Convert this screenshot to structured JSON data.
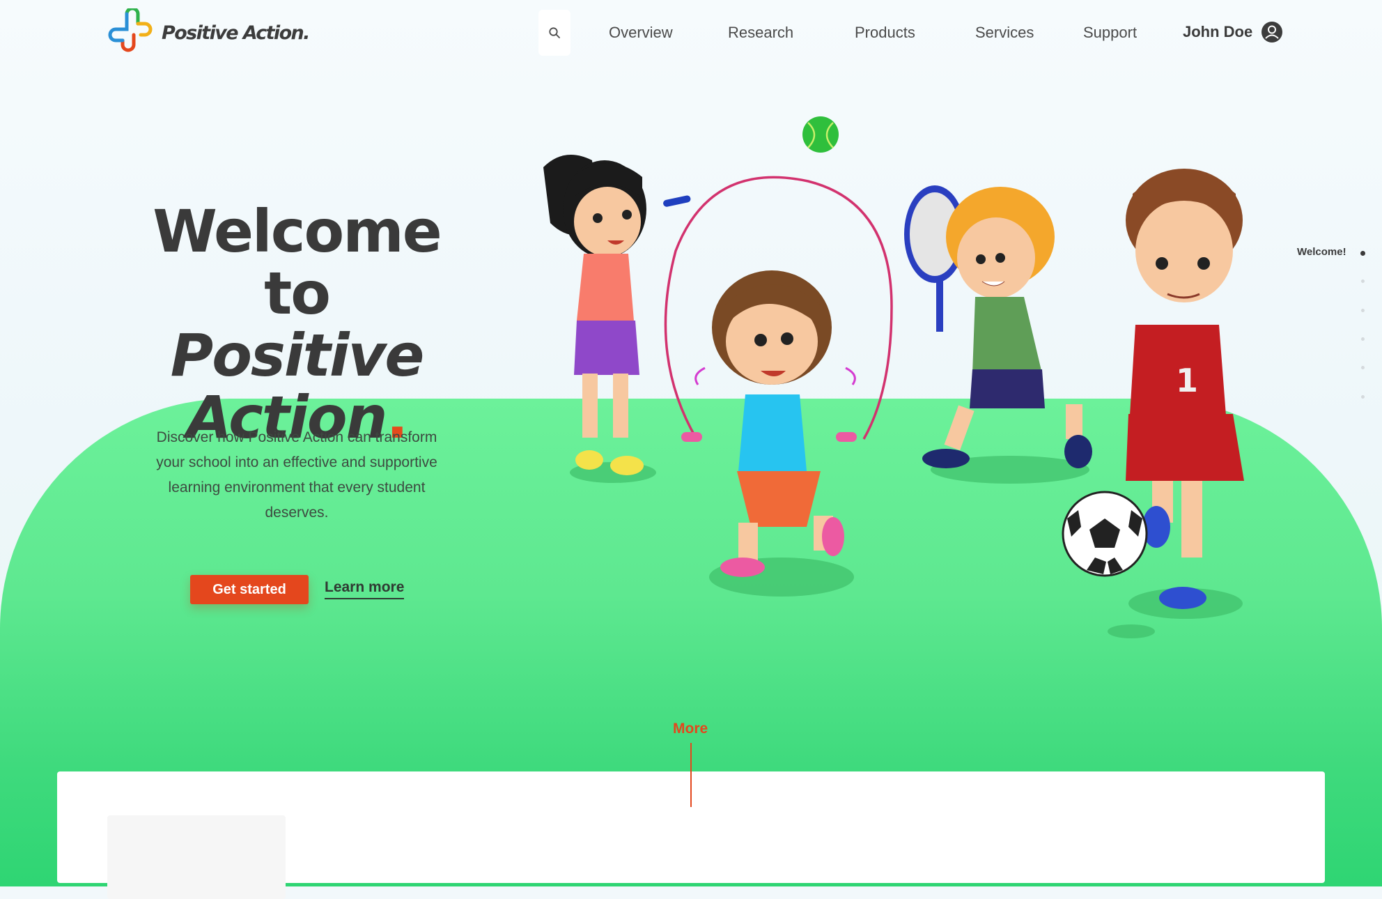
{
  "header": {
    "logo_text": "Positive Action",
    "logo_dot": ".",
    "search_icon": "search-icon",
    "nav": [
      "Overview",
      "Research",
      "Products",
      "Services",
      "Support"
    ],
    "user_name": "John Doe",
    "user_icon": "user-circle-icon"
  },
  "hero": {
    "title_line1": "Welcome",
    "title_line2_prefix": "to ",
    "title_line2_italic": "Positive",
    "title_line3_italic": "Action",
    "title_dot": ".",
    "description": "Discover how Positive Action can transform your school into an effective and supportive learning environment that every student deserves.",
    "primary_button": "Get started",
    "secondary_link": "Learn more"
  },
  "side_nav": {
    "active_label": "Welcome!",
    "dot_count": 6,
    "active_index": 0
  },
  "more": {
    "label": "More"
  },
  "illustration": {
    "subject": "children-playing-sports",
    "jersey_number": "1"
  },
  "colors": {
    "accent": "#e4471d",
    "green_top": "#6cf19a",
    "green_bottom": "#2fd573",
    "text": "#3a3a3a"
  }
}
